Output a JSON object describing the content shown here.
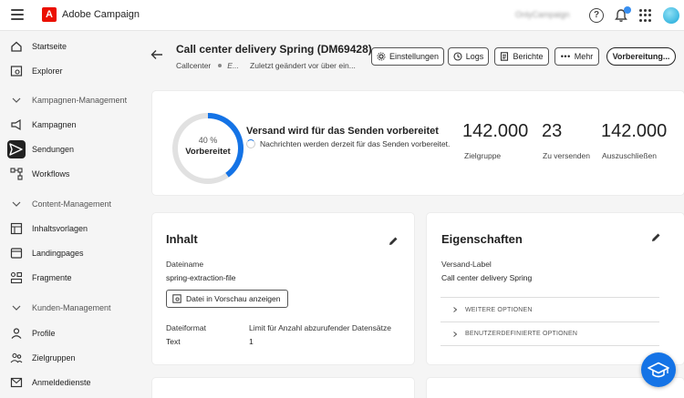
{
  "topbar": {
    "app_name": "Adobe Campaign",
    "org_name": "OnlyCampaign",
    "help_glyph": "?"
  },
  "sidebar": {
    "items": [
      {
        "label": "Startseite",
        "icon": "home-icon"
      },
      {
        "label": "Explorer",
        "icon": "explorer-icon"
      },
      {
        "label": "Kampagnen-Management",
        "icon": "chevron-down-icon",
        "section": true
      },
      {
        "label": "Kampagnen",
        "icon": "megaphone-icon"
      },
      {
        "label": "Sendungen",
        "icon": "send-icon",
        "active": true
      },
      {
        "label": "Workflows",
        "icon": "workflow-icon"
      },
      {
        "label": "Content-Management",
        "icon": "chevron-down-icon",
        "section": true
      },
      {
        "label": "Inhaltsvorlagen",
        "icon": "template-icon"
      },
      {
        "label": "Landingpages",
        "icon": "landingpage-icon"
      },
      {
        "label": "Fragmente",
        "icon": "fragment-icon"
      },
      {
        "label": "Kunden-Management",
        "icon": "chevron-down-icon",
        "section": true
      },
      {
        "label": "Profile",
        "icon": "profile-icon"
      },
      {
        "label": "Zielgruppen",
        "icon": "audience-icon"
      },
      {
        "label": "Anmeldedienste",
        "icon": "subscription-icon"
      }
    ]
  },
  "header": {
    "title": "Call center delivery Spring (DM69428)",
    "channel": "Callcenter",
    "status": "E...",
    "modified": "Zuletzt geändert vor über ein...",
    "buttons": {
      "settings": "Einstellungen",
      "logs": "Logs",
      "reports": "Berichte",
      "more": "Mehr",
      "prepare": "Vorbereitung..."
    }
  },
  "summary": {
    "progress_pct": "40 %",
    "progress_value": 0.4,
    "progress_label": "Vorbereitet",
    "title": "Versand wird für das Senden vorbereitet",
    "subtitle": "Nachrichten werden derzeit für das Senden vorbereitet.",
    "stats": [
      {
        "value": "142.000",
        "label": "Zielgruppe"
      },
      {
        "value": "23",
        "label": "Zu versenden"
      },
      {
        "value": "142.000",
        "label": "Auszuschließen"
      }
    ]
  },
  "content": {
    "title": "Inhalt",
    "filename_label": "Dateiname",
    "filename_value": "spring-extraction-file",
    "preview_button": "Datei in Vorschau anzeigen",
    "format_label": "Dateiformat",
    "format_value": "Text",
    "limit_label": "Limit für Anzahl abzurufender Datensätze",
    "limit_value": "1"
  },
  "properties": {
    "title": "Eigenschaften",
    "label_label": "Versand-Label",
    "label_value": "Call center delivery Spring",
    "more_options": "WEITERE OPTIONEN",
    "custom_options": "BENUTZERDEFINIERTE OPTIONEN"
  },
  "colors": {
    "accent": "#1473e6",
    "ring_track": "#e1e1e1",
    "brand": "#eb1000"
  }
}
